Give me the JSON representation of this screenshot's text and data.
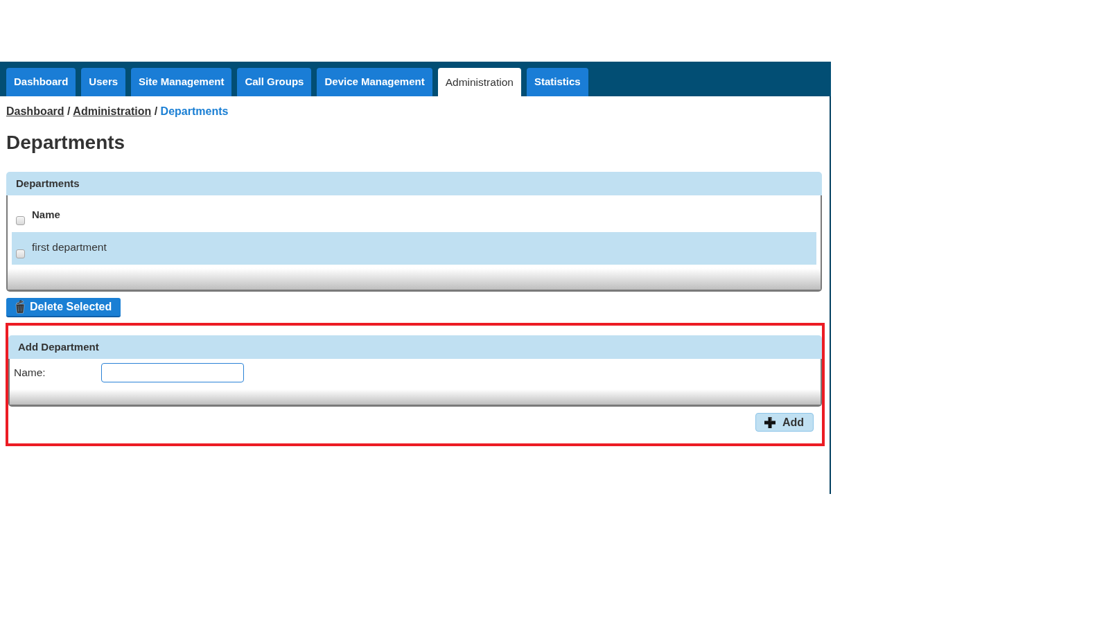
{
  "tabs": [
    {
      "label": "Dashboard",
      "selected": false
    },
    {
      "label": "Users",
      "selected": false
    },
    {
      "label": "Site Management",
      "selected": false
    },
    {
      "label": "Call Groups",
      "selected": false
    },
    {
      "label": "Device Management",
      "selected": false
    },
    {
      "label": "Administration",
      "selected": true
    },
    {
      "label": "Statistics",
      "selected": false
    }
  ],
  "breadcrumb": [
    {
      "kind": "link",
      "label": "Dashboard"
    },
    {
      "kind": "separator",
      "label": "/"
    },
    {
      "kind": "link",
      "label": "Administration"
    },
    {
      "kind": "separator",
      "label": "/"
    },
    {
      "kind": "current",
      "label": "Departments"
    }
  ],
  "page_title": "Departments",
  "departments_panel": {
    "title": "Departments",
    "table": {
      "columns": [
        {
          "label": "Name"
        }
      ],
      "select_all": {
        "checked": false
      },
      "rows": [
        {
          "checked": false,
          "cells": [
            "first department"
          ]
        }
      ]
    }
  },
  "delete_button": {
    "label": "Delete Selected"
  },
  "add_department_panel": {
    "title": "Add Department",
    "fields": [
      {
        "label": "Name:"
      }
    ]
  },
  "add_button": {
    "label": "Add"
  }
}
